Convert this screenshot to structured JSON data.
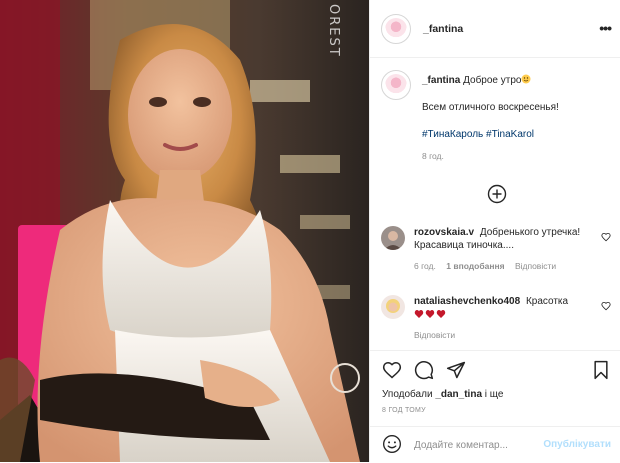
{
  "post": {
    "watermark": "OREST",
    "author": "_fantina",
    "more_icon": "more-horizontal-icon",
    "caption": {
      "user": "_fantina",
      "greeting": "Доброе утро",
      "emoji": "smiling-face",
      "line2": "Всем отличного воскресенья!",
      "hashtags": "#ТинаКароль #TinaKarol",
      "age": "8 год."
    },
    "comments": [
      {
        "user": "rozovskaia.v",
        "text": "Добренького утречка! Красавица тиночка....",
        "age": "6 год.",
        "likes": "1 вподобання",
        "reply": "Відповісти"
      },
      {
        "user": "nataliashevchenko408",
        "text": "Красотка",
        "emoji": "hearts",
        "age": "",
        "reply": "Відповісти"
      }
    ],
    "liked_by_prefix": "Уподобали",
    "liked_by_user": "_dan_tina",
    "liked_by_suffix": "і ще",
    "time": "8 ГОД ТОМУ",
    "add_comment_placeholder": "Додайте коментар...",
    "publish_label": "Опублікувати",
    "colors": {
      "link": "#00376b",
      "muted": "#8e8e8e",
      "heart": "#ed4956",
      "publish_disabled": "#b2dffc"
    }
  }
}
